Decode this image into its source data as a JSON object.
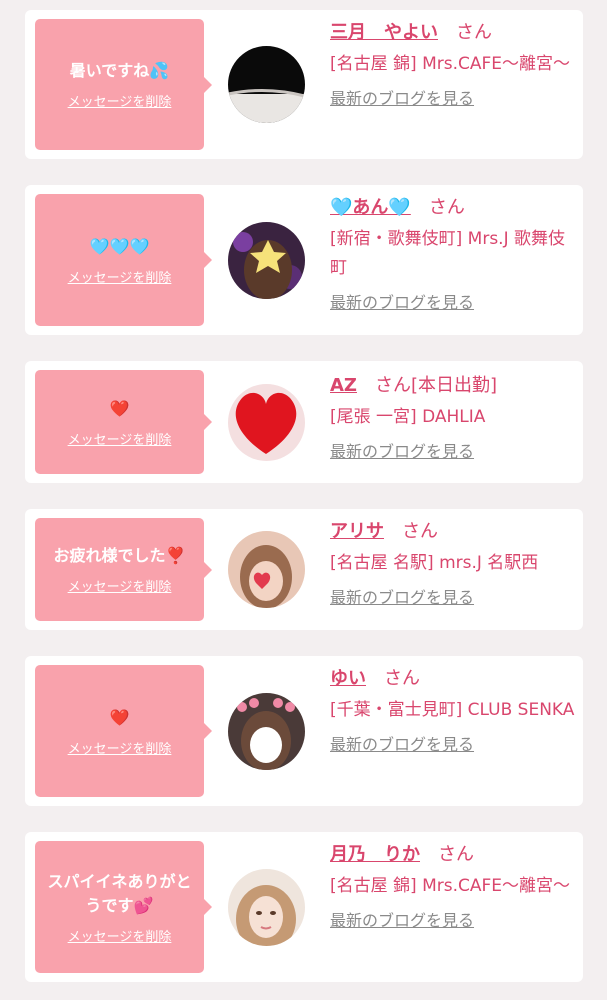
{
  "cards": [
    {
      "message": "暑いですね💦",
      "delete_label": "メッセージを削除",
      "name": "三月　やよい",
      "honorific": "さん",
      "shop": "[名古屋 錦] Mrs.CAFE〜離宮〜",
      "blog_label": "最新のブログを見る"
    },
    {
      "message": "🩵🩵🩵",
      "delete_label": "メッセージを削除",
      "name": "🩵あん🩵",
      "honorific": "さん",
      "shop": "[新宿・歌舞伎町] Mrs.J 歌舞伎町",
      "blog_label": "最新のブログを見る"
    },
    {
      "message": "❤️",
      "delete_label": "メッセージを削除",
      "name": "AZ",
      "honorific": "さん[本日出勤]",
      "shop": "[尾張 一宮] DAHLIA",
      "blog_label": "最新のブログを見る"
    },
    {
      "message": "お疲れ様でした❣️",
      "delete_label": "メッセージを削除",
      "name": "アリサ",
      "honorific": "さん",
      "shop": "[名古屋 名駅] mrs.J 名駅西",
      "blog_label": "最新のブログを見る"
    },
    {
      "message": "❤️",
      "delete_label": "メッセージを削除",
      "name": "ゆい",
      "honorific": "さん",
      "shop": "[千葉・富士見町] CLUB SENKA",
      "blog_label": "最新のブログを見る"
    },
    {
      "message": "スパイイネありがとうです💕",
      "delete_label": "メッセージを削除",
      "name": "月乃　りか",
      "honorific": "さん",
      "shop": "[名古屋 錦] Mrs.CAFE〜離宮〜",
      "blog_label": "最新のブログを見る"
    }
  ],
  "colors": {
    "bubble": "#f9a2ac",
    "accent": "#d9466d",
    "link_gray": "#8a8a8a",
    "background": "#f3eff0"
  }
}
